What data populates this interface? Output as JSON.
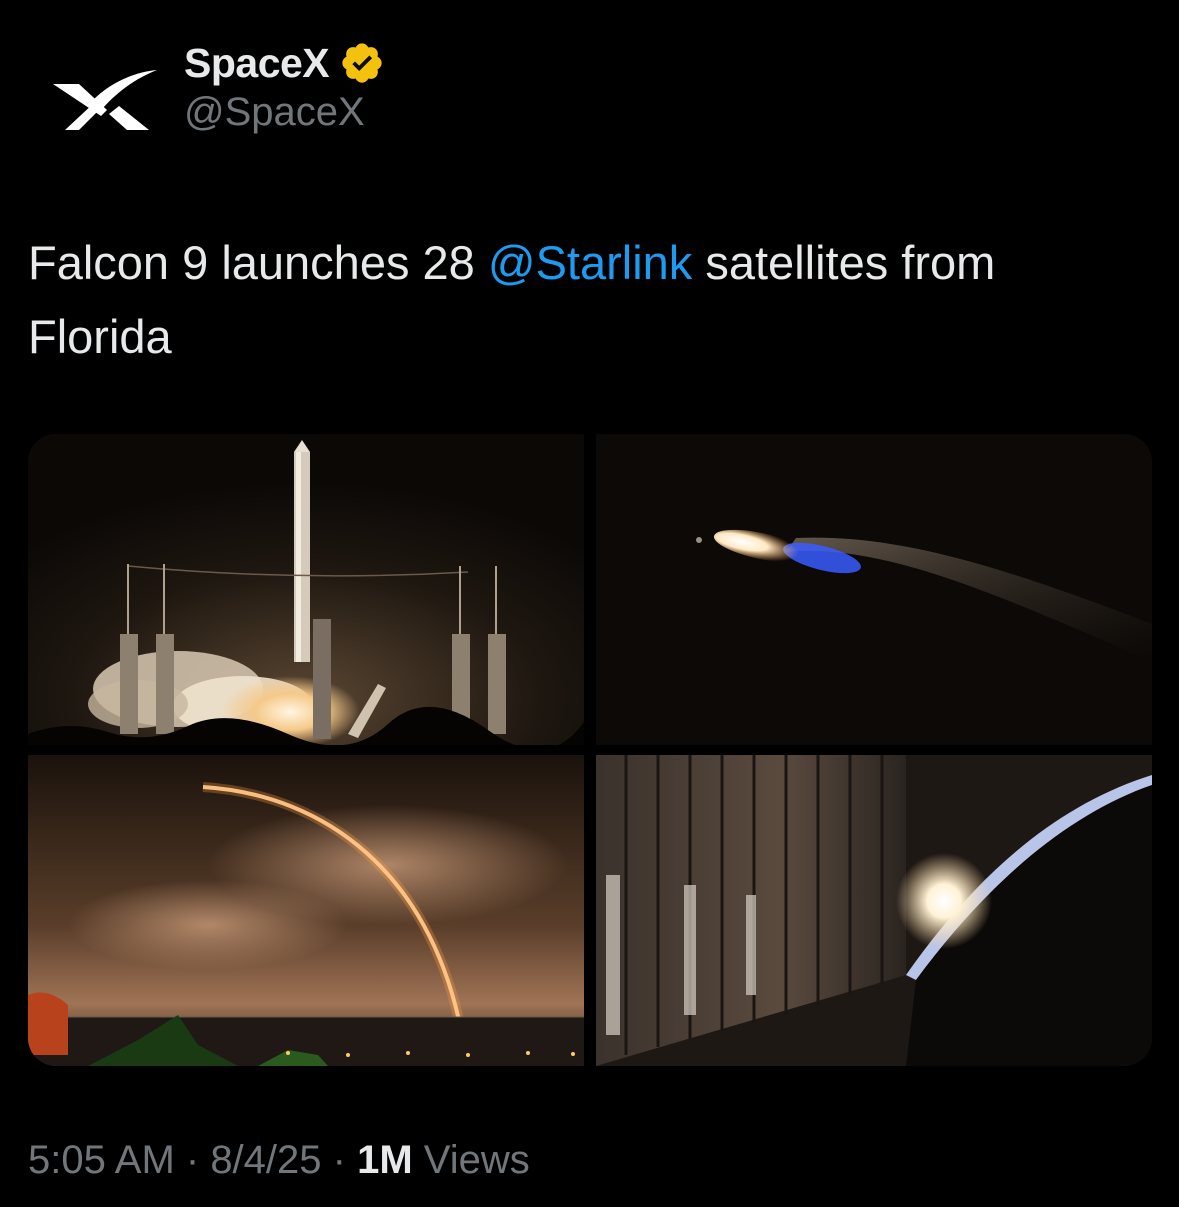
{
  "author": {
    "display_name": "SpaceX",
    "handle": "@SpaceX",
    "avatar_icon": "spacex-x-logo-icon",
    "verified_icon": "verified-badge-icon",
    "verified_color": "#f4c10f"
  },
  "tweet": {
    "text_before": "Falcon 9 launches 28 ",
    "mention": "@Starlink",
    "text_after": " satellites from Florida",
    "mention_color": "#1d9bf0"
  },
  "media": {
    "photos": [
      {
        "name": "launch-pad-photo"
      },
      {
        "name": "rocket-flight-photo"
      },
      {
        "name": "launch-arc-photo"
      },
      {
        "name": "starlink-stack-photo"
      }
    ]
  },
  "meta": {
    "time": "5:05 AM",
    "separator": " · ",
    "date": "8/4/25",
    "views_count": "1M",
    "views_label": " Views"
  },
  "colors": {
    "background": "#000000",
    "primary_text": "#e7e9ea",
    "secondary_text": "#71767b",
    "accent": "#1d9bf0"
  }
}
